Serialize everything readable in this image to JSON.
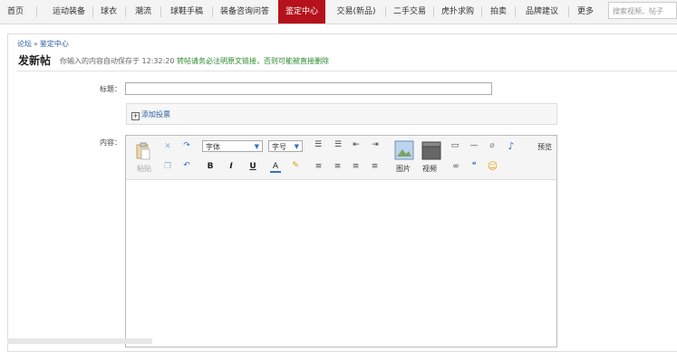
{
  "nav": {
    "items": [
      "首页",
      "运动装备",
      "球衣",
      "潮流",
      "球鞋手稿",
      "装备咨询问答",
      "鉴定中心",
      "交易(新品)",
      "二手交易",
      "虎扑求购",
      "拍卖",
      "品牌建议",
      "更多"
    ],
    "active_index": 6,
    "search_placeholder": "搜索视频、帖子"
  },
  "breadcrumb": {
    "home": "论坛",
    "separator": "»",
    "current": "鉴定中心"
  },
  "page": {
    "title": "发新帖",
    "autosave": "你输入的内容自动保存于 12:32:20",
    "warning": "转帖请务必注明原文链接，否则可能被直接删除"
  },
  "form": {
    "title_label": "标题：",
    "title_value": "",
    "poll_link": "添加投票",
    "content_label": "内容："
  },
  "toolbar": {
    "paste": "粘贴",
    "font_select": "字体",
    "size_select": "字号",
    "image": "图片",
    "video": "视频",
    "preview": "预览"
  },
  "colors": {
    "accent": "#b5121b",
    "link": "#2a5ea5",
    "warning": "#2a8a2a"
  }
}
